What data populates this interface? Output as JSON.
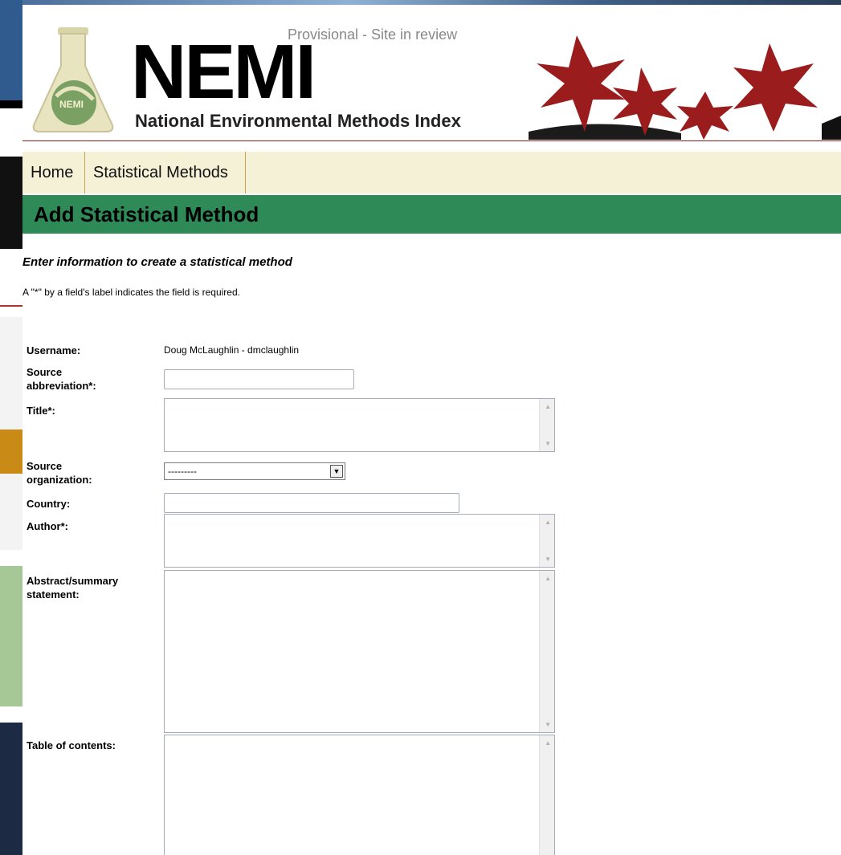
{
  "header": {
    "logo_text": "NEMI",
    "flask_label": "NEMI",
    "subtitle": "National Environmental Methods Index",
    "provisional": "Provisional - Site in review"
  },
  "nav": {
    "items": [
      {
        "label": "Home"
      },
      {
        "label": "Statistical Methods"
      }
    ]
  },
  "page": {
    "title": "Add Statistical Method",
    "intro": "Enter information to create a statistical method",
    "required_note": "A \"*\" by a field's label indicates the field is required."
  },
  "form": {
    "username_label": "Username:",
    "username_value": "Doug McLaughlin - dmclaughlin",
    "source_abbreviation_label": "Source abbreviation*:",
    "source_abbreviation_value": "",
    "title_label": "Title*:",
    "title_value": "",
    "source_organization_label": "Source organization:",
    "source_organization_value": "---------",
    "country_label": "Country:",
    "country_value": "",
    "author_label": "Author*:",
    "author_value": "",
    "abstract_label": "Abstract/summary statement:",
    "abstract_value": "",
    "toc_label": "Table of contents:",
    "toc_value": ""
  },
  "colors": {
    "banner": "#2e8b57",
    "nav_bg": "#f5f1d7",
    "nav_divider": "#c8a54c",
    "header_rule": "#8b1a1a"
  }
}
